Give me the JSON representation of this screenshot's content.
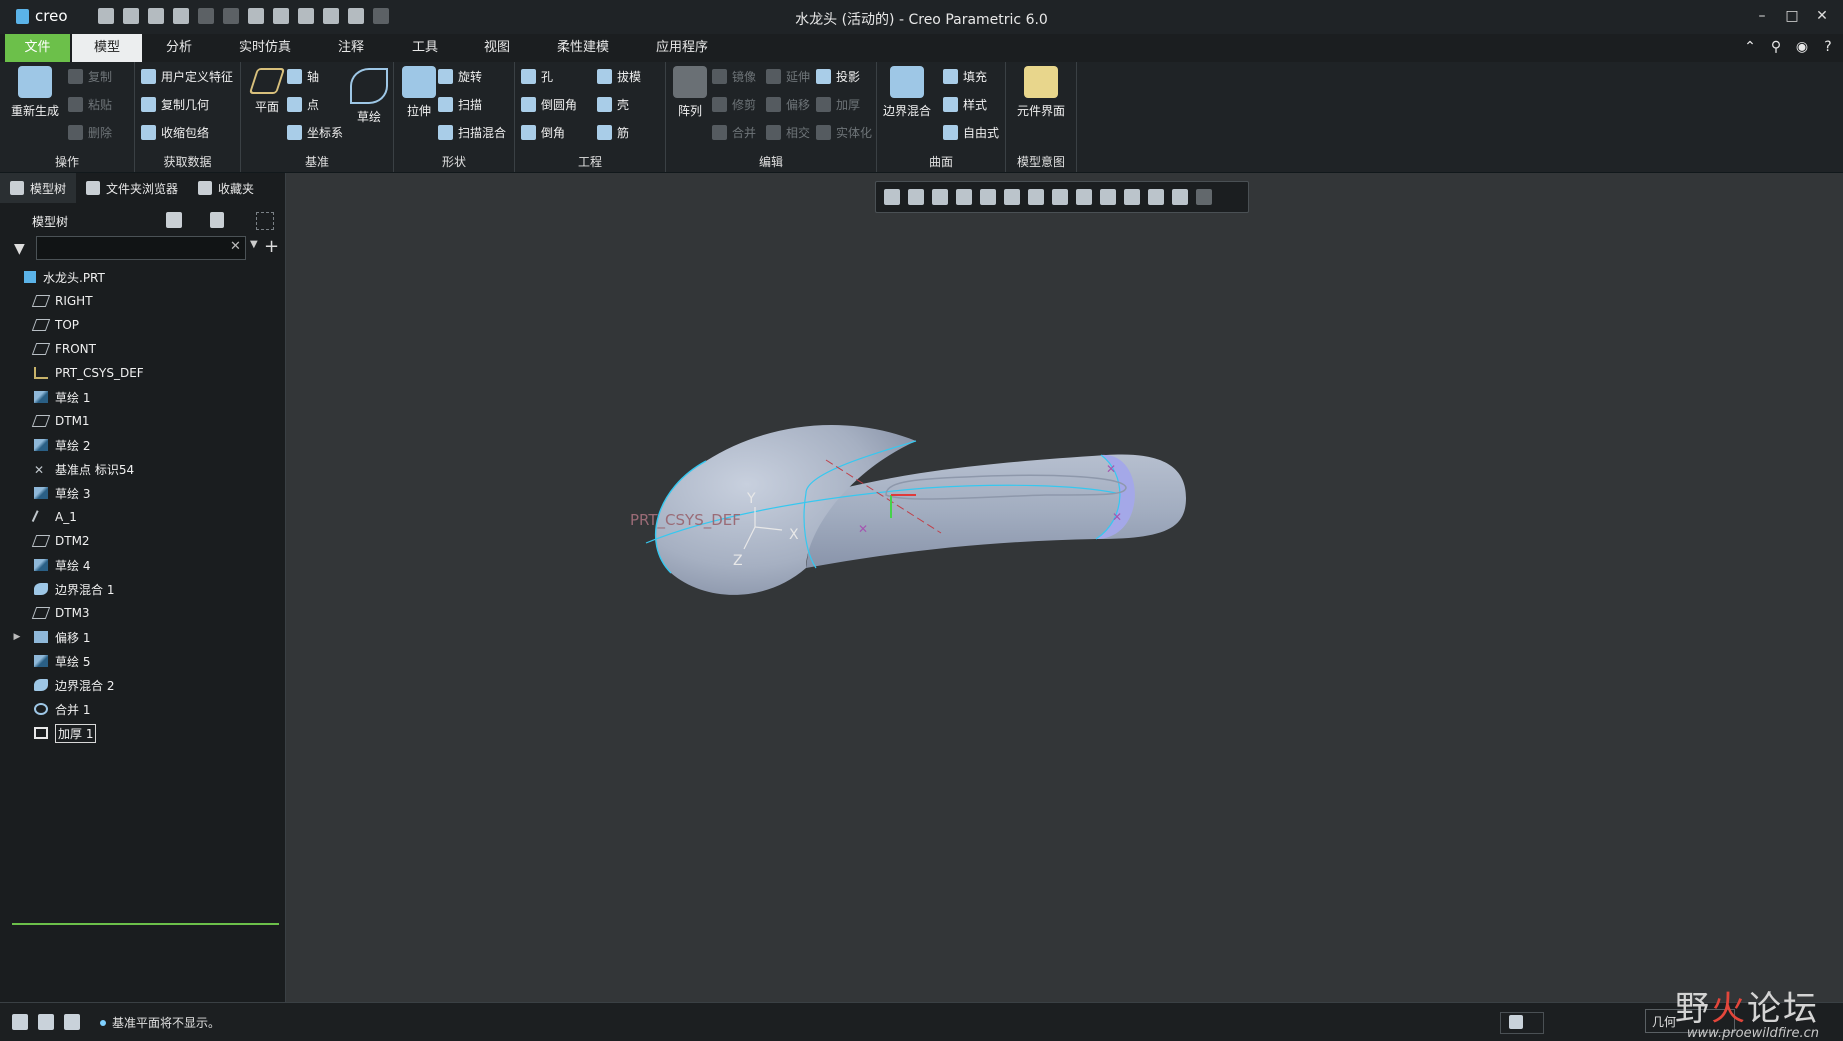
{
  "app": {
    "logo_text": "creo",
    "window_title": "水龙头 (活动的) - Creo Parametric 6.0"
  },
  "window_controls": {
    "minimize": "–",
    "maximize": "□",
    "close": "✕"
  },
  "tabs": [
    "文件",
    "模型",
    "分析",
    "实时仿真",
    "注释",
    "工具",
    "视图",
    "柔性建模",
    "应用程序"
  ],
  "ribbon": {
    "operations": {
      "label": "操作",
      "regenerate": "重新生成",
      "copy": "复制",
      "paste": "粘贴",
      "delete": "删除"
    },
    "get_data": {
      "label": "获取数据",
      "udf": "用户定义特征",
      "copy_geom": "复制几何",
      "shrinkwrap": "收缩包络"
    },
    "datum": {
      "label": "基准",
      "plane": "平面",
      "axis": "轴",
      "point": "点",
      "csys": "坐标系",
      "sketch": "草绘"
    },
    "shapes": {
      "label": "形状",
      "extrude": "拉伸",
      "revolve": "旋转",
      "sweep": "扫描",
      "swept_blend": "扫描混合"
    },
    "engineering": {
      "label": "工程",
      "hole": "孔",
      "round": "倒圆角",
      "chamfer": "倒角",
      "draft": "拔模",
      "shell": "壳",
      "rib": "筋"
    },
    "editing": {
      "label": "编辑",
      "pattern": "阵列",
      "mirror": "镜像",
      "extend": "延伸",
      "project": "投影",
      "trim": "修剪",
      "offset": "偏移",
      "thicken": "加厚",
      "merge": "合并",
      "intersect": "相交",
      "solidify": "实体化"
    },
    "surfaces": {
      "label": "曲面",
      "boundary_blend": "边界混合",
      "fill": "填充",
      "style": "样式",
      "freestyle": "自由式"
    },
    "model_intent": {
      "label": "模型意图",
      "component_interface": "元件界面"
    }
  },
  "nav": {
    "model_tree": "模型树",
    "folder_browser": "文件夹浏览器",
    "favorites": "收藏夹"
  },
  "tree_header": "模型树",
  "search": {
    "value": "",
    "placeholder": ""
  },
  "tree": [
    {
      "label": "水龙头.PRT",
      "icon": "part"
    },
    {
      "label": "RIGHT",
      "icon": "datum-plane"
    },
    {
      "label": "TOP",
      "icon": "datum-plane"
    },
    {
      "label": "FRONT",
      "icon": "datum-plane"
    },
    {
      "label": "PRT_CSYS_DEF",
      "icon": "csys"
    },
    {
      "label": "草绘 1",
      "icon": "sketch"
    },
    {
      "label": "DTM1",
      "icon": "datum-plane"
    },
    {
      "label": "草绘 2",
      "icon": "sketch"
    },
    {
      "label": "基准点 标识54",
      "icon": "datum-point"
    },
    {
      "label": "草绘 3",
      "icon": "sketch"
    },
    {
      "label": "A_1",
      "icon": "axis"
    },
    {
      "label": "DTM2",
      "icon": "datum-plane"
    },
    {
      "label": "草绘 4",
      "icon": "sketch"
    },
    {
      "label": "边界混合 1",
      "icon": "boundary-blend"
    },
    {
      "label": "DTM3",
      "icon": "datum-plane"
    },
    {
      "label": "偏移 1",
      "icon": "offset"
    },
    {
      "label": "草绘 5",
      "icon": "sketch"
    },
    {
      "label": "边界混合 2",
      "icon": "boundary-blend"
    },
    {
      "label": "合并 1",
      "icon": "merge"
    },
    {
      "label": "加厚 1",
      "icon": "thicken"
    }
  ],
  "viewport": {
    "csys_label": "PRT_CSYS_DEF",
    "axis_x": "X",
    "axis_y": "Y",
    "axis_z": "Z"
  },
  "status": {
    "message": "基准平面将不显示。",
    "selection_filter": "几何"
  },
  "watermark": {
    "title_a": "野",
    "title_b": "火",
    "title_c": "论坛",
    "url": "www.proewildfire.cn"
  },
  "colors": {
    "file_tab": "#6cc04a",
    "surface": "#a8b2c4",
    "edge": "#36c8f0",
    "background": "#333638"
  }
}
